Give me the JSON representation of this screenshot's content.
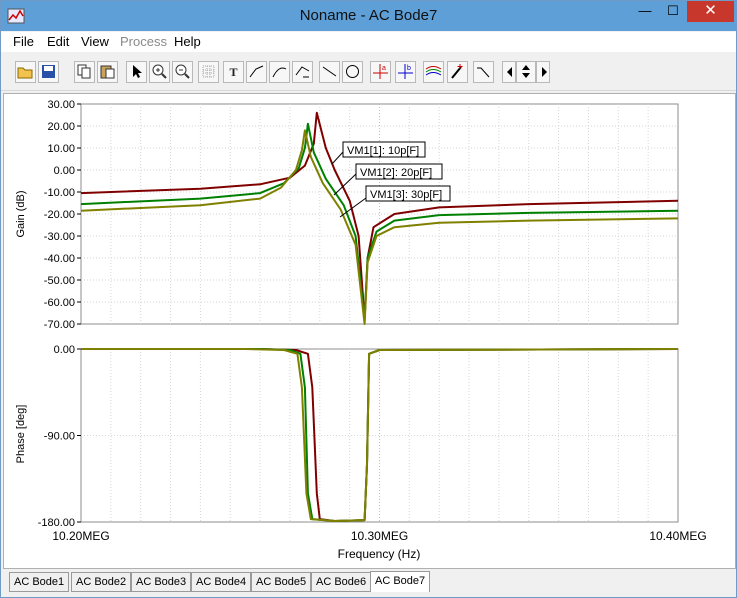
{
  "window": {
    "title": "Noname - AC Bode7",
    "minimize": "—",
    "maximize": "☐",
    "close": "✕"
  },
  "menu": {
    "items": [
      {
        "label": "File",
        "enabled": true
      },
      {
        "label": "Edit",
        "enabled": true
      },
      {
        "label": "View",
        "enabled": true
      },
      {
        "label": "Process",
        "enabled": false
      },
      {
        "label": "Help",
        "enabled": true
      }
    ]
  },
  "toolbar": {
    "icons": [
      "open-file-icon",
      "save-icon",
      "copy-icon",
      "paste-icon",
      "pointer-icon",
      "zoom-in-icon",
      "zoom-out-icon",
      "grid-icon",
      "text-tool-icon",
      "curve-label-icon",
      "curve-tool-icon",
      "curve-rescale-icon",
      "line-tool-icon",
      "circle-tool-icon",
      "cursor-a-icon",
      "cursor-b-icon",
      "multi-curve-icon",
      "probe-icon",
      "step-icon",
      "nav-left-icon",
      "nav-up-down-icon",
      "nav-right-icon"
    ],
    "text_tool_label": "T"
  },
  "colors": {
    "series1": "#800000",
    "series2": "#008000",
    "series3": "#808000"
  },
  "chart_data": [
    {
      "type": "line",
      "ylabel": "Gain (dB)",
      "ylim": [
        -70,
        30
      ],
      "yticks": [
        "30.00",
        "20.00",
        "10.00",
        "0.00",
        "-10.00",
        "-20.00",
        "-30.00",
        "-40.00",
        "-50.00",
        "-60.00",
        "-70.00"
      ],
      "xlim": [
        10200000,
        10400000
      ],
      "grid": "on (log-style minor)",
      "series": [
        {
          "name": "VM1[1]: 10p[F]",
          "x": [
            10200000,
            10240000,
            10260000,
            10270000,
            10275000,
            10278000,
            10279000,
            10282000,
            10285000,
            10290000,
            10293000,
            10295000,
            10296000,
            10298000,
            10305000,
            10320000,
            10350000,
            10400000
          ],
          "values": [
            -10.5,
            -8.5,
            -6.5,
            -3.5,
            2,
            12,
            26,
            10,
            0,
            -14,
            -30,
            -68,
            -40,
            -26,
            -20,
            -17,
            -15.5,
            -14
          ]
        },
        {
          "name": "VM1[2]: 20p[F]",
          "x": [
            10200000,
            10240000,
            10260000,
            10268000,
            10273000,
            10275000,
            10276000,
            10278000,
            10282000,
            10288000,
            10292000,
            10295000,
            10296000,
            10299000,
            10305000,
            10320000,
            10350000,
            10400000
          ],
          "values": [
            -15.5,
            -13,
            -10.5,
            -6,
            1,
            10,
            21,
            8,
            -4,
            -16,
            -30,
            -68,
            -40,
            -28,
            -23,
            -20.5,
            -19.5,
            -18.5
          ]
        },
        {
          "name": "VM1[3]: 30p[F]",
          "x": [
            10200000,
            10240000,
            10260000,
            10267000,
            10272000,
            10274000,
            10275000,
            10277000,
            10281000,
            10287000,
            10292000,
            10295000,
            10296000,
            10299000,
            10305000,
            10320000,
            10350000,
            10400000
          ],
          "values": [
            -18.5,
            -16,
            -13,
            -8,
            0,
            9,
            18,
            6,
            -6,
            -18,
            -34,
            -70,
            -42,
            -30,
            -26,
            -24,
            -23,
            -22
          ]
        }
      ],
      "annotations": [
        "VM1[1]: 10p[F]",
        "VM1[2]: 20p[F]",
        "VM1[3]: 30p[F]"
      ]
    },
    {
      "type": "line",
      "xlabel": "Frequency (Hz)",
      "ylabel": "Phase [deg]",
      "ylim": [
        -180,
        0
      ],
      "yticks": [
        "0.00",
        "-90.00",
        "-180.00"
      ],
      "xticks": [
        "10.20MEG",
        "10.30MEG",
        "10.40MEG"
      ],
      "xlim": [
        10200000,
        10400000
      ],
      "series": [
        {
          "name": "VM1[1]: 10p[F]",
          "x": [
            10200000,
            10260000,
            10272000,
            10276000,
            10277500,
            10279000,
            10280000,
            10285000,
            10295000,
            10295800,
            10296500,
            10300000,
            10400000
          ],
          "values": [
            0,
            0,
            -1,
            -5,
            -40,
            -150,
            -177,
            -179,
            -178,
            -120,
            -5,
            -1,
            0
          ]
        },
        {
          "name": "VM1[2]: 20p[F]",
          "x": [
            10200000,
            10260000,
            10270000,
            10273500,
            10275000,
            10276000,
            10277500,
            10285000,
            10295000,
            10295800,
            10296500,
            10300000,
            10400000
          ],
          "values": [
            0,
            0,
            -1,
            -5,
            -40,
            -150,
            -177,
            -179,
            -178,
            -120,
            -5,
            -1,
            0
          ]
        },
        {
          "name": "VM1[3]: 30p[F]",
          "x": [
            10200000,
            10255000,
            10268000,
            10272500,
            10274000,
            10275500,
            10277000,
            10285000,
            10295000,
            10295800,
            10296500,
            10300000,
            10400000
          ],
          "values": [
            0,
            0,
            -1,
            -5,
            -40,
            -150,
            -177,
            -179,
            -178,
            -120,
            -5,
            -1,
            0
          ]
        }
      ]
    }
  ],
  "tabs": [
    {
      "label": "AC Bode1",
      "active": false
    },
    {
      "label": "AC Bode2",
      "active": false
    },
    {
      "label": "AC Bode3",
      "active": false
    },
    {
      "label": "AC Bode4",
      "active": false
    },
    {
      "label": "AC Bode5",
      "active": false
    },
    {
      "label": "AC Bode6",
      "active": false
    },
    {
      "label": "AC Bode7",
      "active": true
    }
  ]
}
